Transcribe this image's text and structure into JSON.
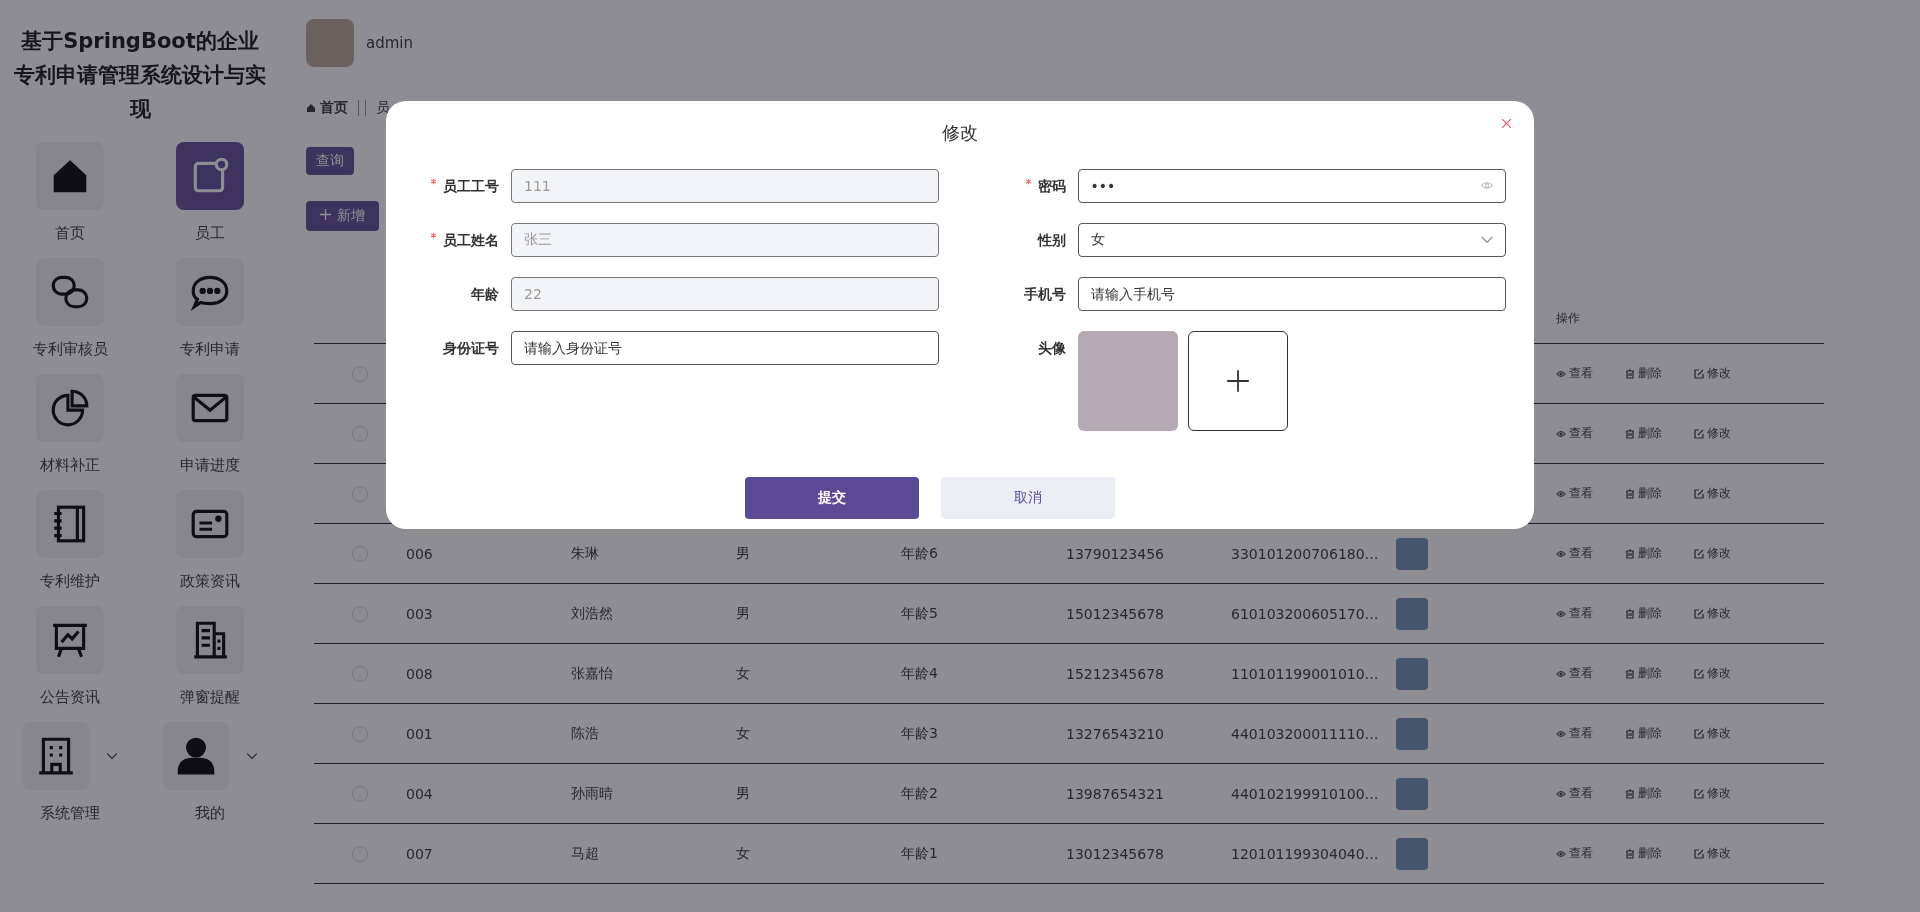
{
  "sidebar": {
    "title": "基于SpringBoot的企业专利申请管理系统设计与实现",
    "items": [
      {
        "label": "首页",
        "selected": false,
        "submenu": false
      },
      {
        "label": "员工",
        "selected": true,
        "submenu": false
      },
      {
        "label": "专利审核员",
        "selected": false,
        "submenu": false
      },
      {
        "label": "专利申请",
        "selected": false,
        "submenu": false
      },
      {
        "label": "材料补正",
        "selected": false,
        "submenu": false
      },
      {
        "label": "申请进度",
        "selected": false,
        "submenu": false
      },
      {
        "label": "专利维护",
        "selected": false,
        "submenu": false
      },
      {
        "label": "政策资讯",
        "selected": false,
        "submenu": false
      },
      {
        "label": "公告资讯",
        "selected": false,
        "submenu": false
      },
      {
        "label": "弹窗提醒",
        "selected": false,
        "submenu": false
      },
      {
        "label": "系统管理",
        "selected": false,
        "submenu": true
      },
      {
        "label": "我的",
        "selected": false,
        "submenu": true
      }
    ]
  },
  "header": {
    "username": "admin"
  },
  "breadcrumb": {
    "home": "首页",
    "current": "员"
  },
  "toolbar": {
    "search_button": "查询",
    "add_button": "新增"
  },
  "table": {
    "columns": [
      "操作"
    ],
    "rows": [
      {
        "checked": false,
        "cells": [],
        "actions": [
          "查看",
          "删除",
          "修改"
        ]
      },
      {
        "checked": false,
        "cells": [],
        "actions": [
          "查看",
          "删除",
          "修改"
        ]
      },
      {
        "checked": false,
        "cells": [],
        "actions": [
          "查看",
          "删除",
          "修改"
        ]
      },
      {
        "checked": false,
        "cells": [
          "006",
          "朱琳",
          "男",
          "年龄6",
          "13790123456",
          "330101200706180…"
        ],
        "actions": [
          "查看",
          "删除",
          "修改"
        ]
      },
      {
        "checked": false,
        "cells": [
          "003",
          "刘浩然",
          "男",
          "年龄5",
          "15012345678",
          "610103200605170…"
        ],
        "actions": [
          "查看",
          "删除",
          "修改"
        ]
      },
      {
        "checked": false,
        "cells": [
          "008",
          "张嘉怡",
          "女",
          "年龄4",
          "15212345678",
          "110101199001010…"
        ],
        "actions": [
          "查看",
          "删除",
          "修改"
        ]
      },
      {
        "checked": false,
        "cells": [
          "001",
          "陈浩",
          "女",
          "年龄3",
          "13276543210",
          "440103200011110…"
        ],
        "actions": [
          "查看",
          "删除",
          "修改"
        ]
      },
      {
        "checked": false,
        "cells": [
          "004",
          "孙雨晴",
          "男",
          "年龄2",
          "13987654321",
          "440102199910100…"
        ],
        "actions": [
          "查看",
          "删除",
          "修改"
        ]
      },
      {
        "checked": false,
        "cells": [
          "007",
          "马超",
          "女",
          "年龄1",
          "13012345678",
          "120101199304040…"
        ],
        "actions": [
          "查看",
          "删除",
          "修改"
        ]
      }
    ]
  },
  "dialog": {
    "title": "修改",
    "fields": [
      {
        "label": "员工工号",
        "kind": "text",
        "required": true,
        "disabled": true,
        "value": "111"
      },
      {
        "label": "密码",
        "kind": "password",
        "required": true,
        "disabled": false,
        "value": "•••"
      },
      {
        "label": "员工姓名",
        "kind": "text",
        "required": true,
        "disabled": true,
        "value": "张三"
      },
      {
        "label": "性别",
        "kind": "select",
        "required": false,
        "disabled": false,
        "value": "女"
      },
      {
        "label": "年龄",
        "kind": "text",
        "required": false,
        "disabled": true,
        "value": "22"
      },
      {
        "label": "手机号",
        "kind": "text",
        "required": false,
        "disabled": false,
        "placeholder": "请输入手机号"
      },
      {
        "label": "身份证号",
        "kind": "text",
        "required": false,
        "disabled": false,
        "placeholder": "请输入身份证号"
      },
      {
        "label": "头像",
        "kind": "upload",
        "required": false,
        "disabled": false
      }
    ],
    "submit_button": "提交",
    "cancel_button": "取消"
  }
}
